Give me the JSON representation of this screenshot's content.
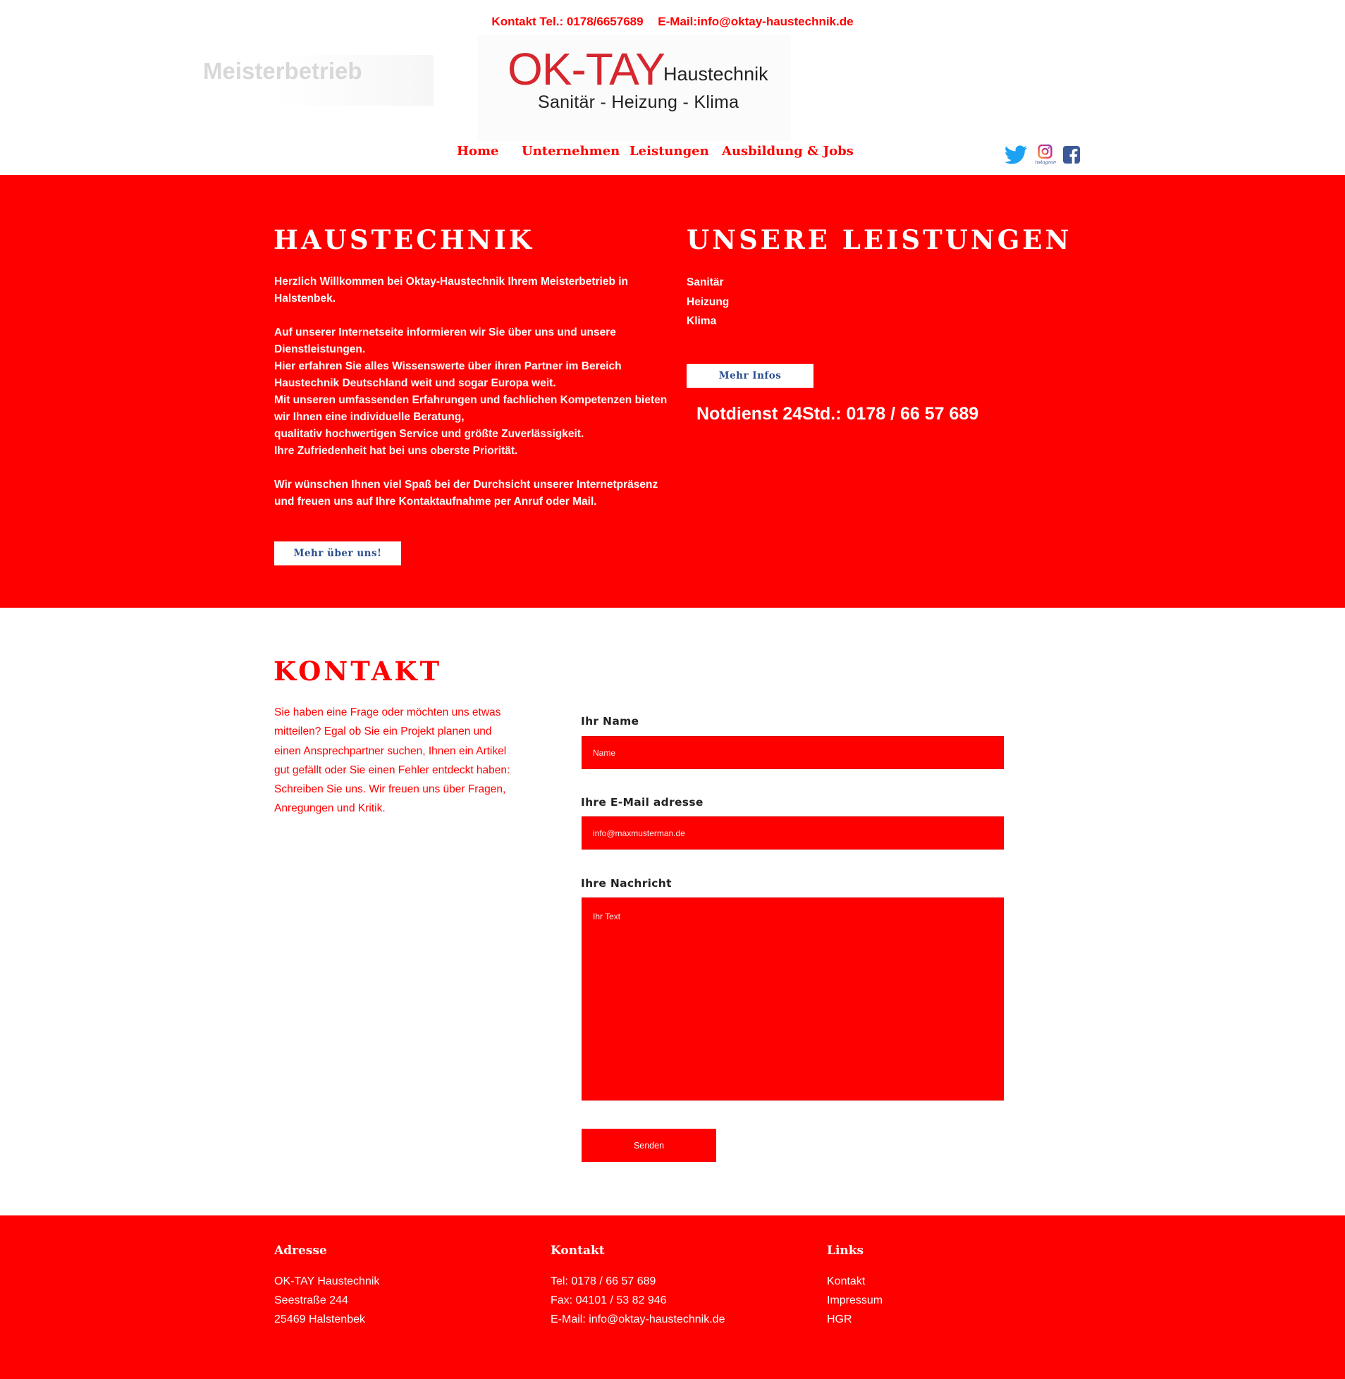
{
  "topbar": {
    "phone": "Kontakt Tel.: 0178/6657689",
    "email": "E-Mail:info@oktay-haustechnik.de"
  },
  "header": {
    "meister": "Meisterbetrieb",
    "logo_main": "OK-TAY",
    "logo_sub": "Haustechnik",
    "logo_tagline": "Sanitär - Heizung - Klima"
  },
  "nav": {
    "items": [
      "Home",
      "Unternehmen",
      "Leistungen",
      "Ausbildung & Jobs"
    ]
  },
  "social": {
    "twitter": "twitter-icon",
    "instagram": "instagram-icon",
    "instagram_caption": "Instagram",
    "facebook": "facebook-icon"
  },
  "colors": {
    "brand_red": "#ff0000",
    "logo_red": "#d7262e",
    "button_text": "#2b4e8f"
  },
  "haustechnik": {
    "title": "HAUSTECHNIK",
    "p1": "Herzlich Willkommen bei Oktay-Haustechnik Ihrem Meisterbetrieb in Halstenbek.",
    "p2_lines": [
      "Auf unserer Internetseite informieren wir Sie über uns und unsere Dienstleistungen.",
      "Hier erfahren Sie alles Wissenswerte über ihren Partner im Bereich Haustechnik Deutschland weit und sogar Europa weit.",
      "Mit unseren umfassenden Erfahrungen und fachlichen Kompetenzen bieten wir Ihnen eine individuelle Beratung,",
      "qualitativ hochwertigen Service und größte Zuverlässigkeit.",
      "Ihre Zufriedenheit hat bei uns oberste Priorität."
    ],
    "p3": "Wir wünschen Ihnen viel Spaß bei der Durchsicht unserer Internetpräsenz und freuen uns auf Ihre Kontaktaufnahme per Anruf oder Mail.",
    "button": "Mehr über uns!"
  },
  "leistungen": {
    "title": "UNSERE LEISTUNGEN",
    "items": [
      "Sanitär",
      "Heizung",
      "Klima"
    ],
    "button": "Mehr Infos",
    "notdienst": "Notdienst 24Std.: 0178 / 66 57 689"
  },
  "kontakt": {
    "title": "KONTAKT",
    "lead": "Sie haben eine Frage oder möchten uns etwas mitteilen?",
    "text": " Egal ob Sie ein Projekt planen und einen Ansprechpartner suchen, Ihnen ein Artikel gut gefällt oder Sie einen Fehler entdeckt haben: Schreiben Sie uns. Wir freuen uns über Fragen, Anregungen und Kritik.",
    "form": {
      "name_label": "Ihr Name",
      "name_placeholder": "Name",
      "email_label": "Ihre E-Mail adresse",
      "email_placeholder": "info@maxmusterman.de",
      "message_label": "Ihre Nachricht",
      "message_placeholder": "Ihr Text",
      "submit": "Senden"
    }
  },
  "footer": {
    "adresse": {
      "title": "Adresse",
      "lines": [
        "OK-TAY Haustechnik",
        "Seestraße 244",
        "25469 Halstenbek"
      ]
    },
    "kontakt": {
      "title": "Kontakt",
      "lines": [
        "Tel: 0178 / 66 57 689",
        "Fax: 04101 / 53 82 946",
        "E-Mail: info@oktay-haustechnik.de"
      ]
    },
    "links": {
      "title": "Links",
      "items": [
        "Kontakt",
        "Impressum",
        "HGR"
      ]
    }
  }
}
